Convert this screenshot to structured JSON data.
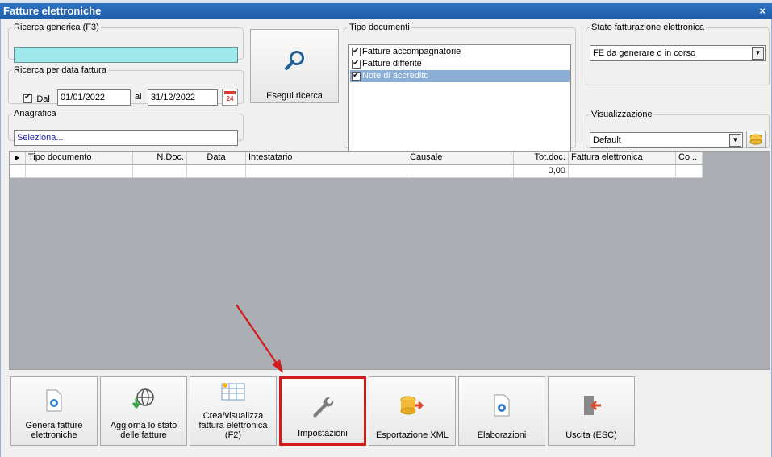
{
  "window": {
    "title": "Fatture elettroniche",
    "close_glyph": "×"
  },
  "search": {
    "generic_legend": "Ricerca generica (F3)",
    "generic_value": "",
    "date_legend": "Ricerca per data fattura",
    "dal_label": "Dal",
    "dal_checked": true,
    "date_from": "01/01/2022",
    "al_label": "al",
    "date_to": "31/12/2022",
    "calendar_badge": "24",
    "anagrafica_legend": "Anagrafica",
    "anagrafica_placeholder": "Seleziona...",
    "button_label": "Esegui ricerca"
  },
  "tipo_documenti": {
    "legend": "Tipo documenti",
    "items": [
      {
        "label": "Fatture accompagnatorie",
        "checked": true,
        "selected": false
      },
      {
        "label": "Fatture differite",
        "checked": true,
        "selected": false
      },
      {
        "label": "Note di accredito",
        "checked": true,
        "selected": true
      }
    ]
  },
  "stato": {
    "legend": "Stato fatturazione elettronica",
    "selected": "FE da generare o in corso"
  },
  "visualizzazione": {
    "legend": "Visualizzazione",
    "selected": "Default"
  },
  "table": {
    "columns": [
      "Tipo documento",
      "N.Doc.",
      "Data",
      "Intestatario",
      "Causale",
      "Tot.doc.",
      "Fattura elettronica",
      "Co..."
    ],
    "total_value": "0,00"
  },
  "toolbar": {
    "genera_label": "Genera fatture elettroniche",
    "aggiorna_label": "Aggiorna lo stato delle fatture",
    "crea_label": "Crea/visualizza fattura elettronica (F2)",
    "impostazioni_label": "Impostazioni",
    "esportazione_label": "Esportazione XML",
    "elaborazioni_label": "Elaborazioni",
    "uscita_label": "Uscita (ESC)"
  },
  "colors": {
    "title_bar": "#1d5ca8",
    "search_input_bg": "#9fe8ec",
    "selection": "#8aaed6",
    "highlight_red": "#d11a1a",
    "grid_bg": "#abafb4"
  }
}
